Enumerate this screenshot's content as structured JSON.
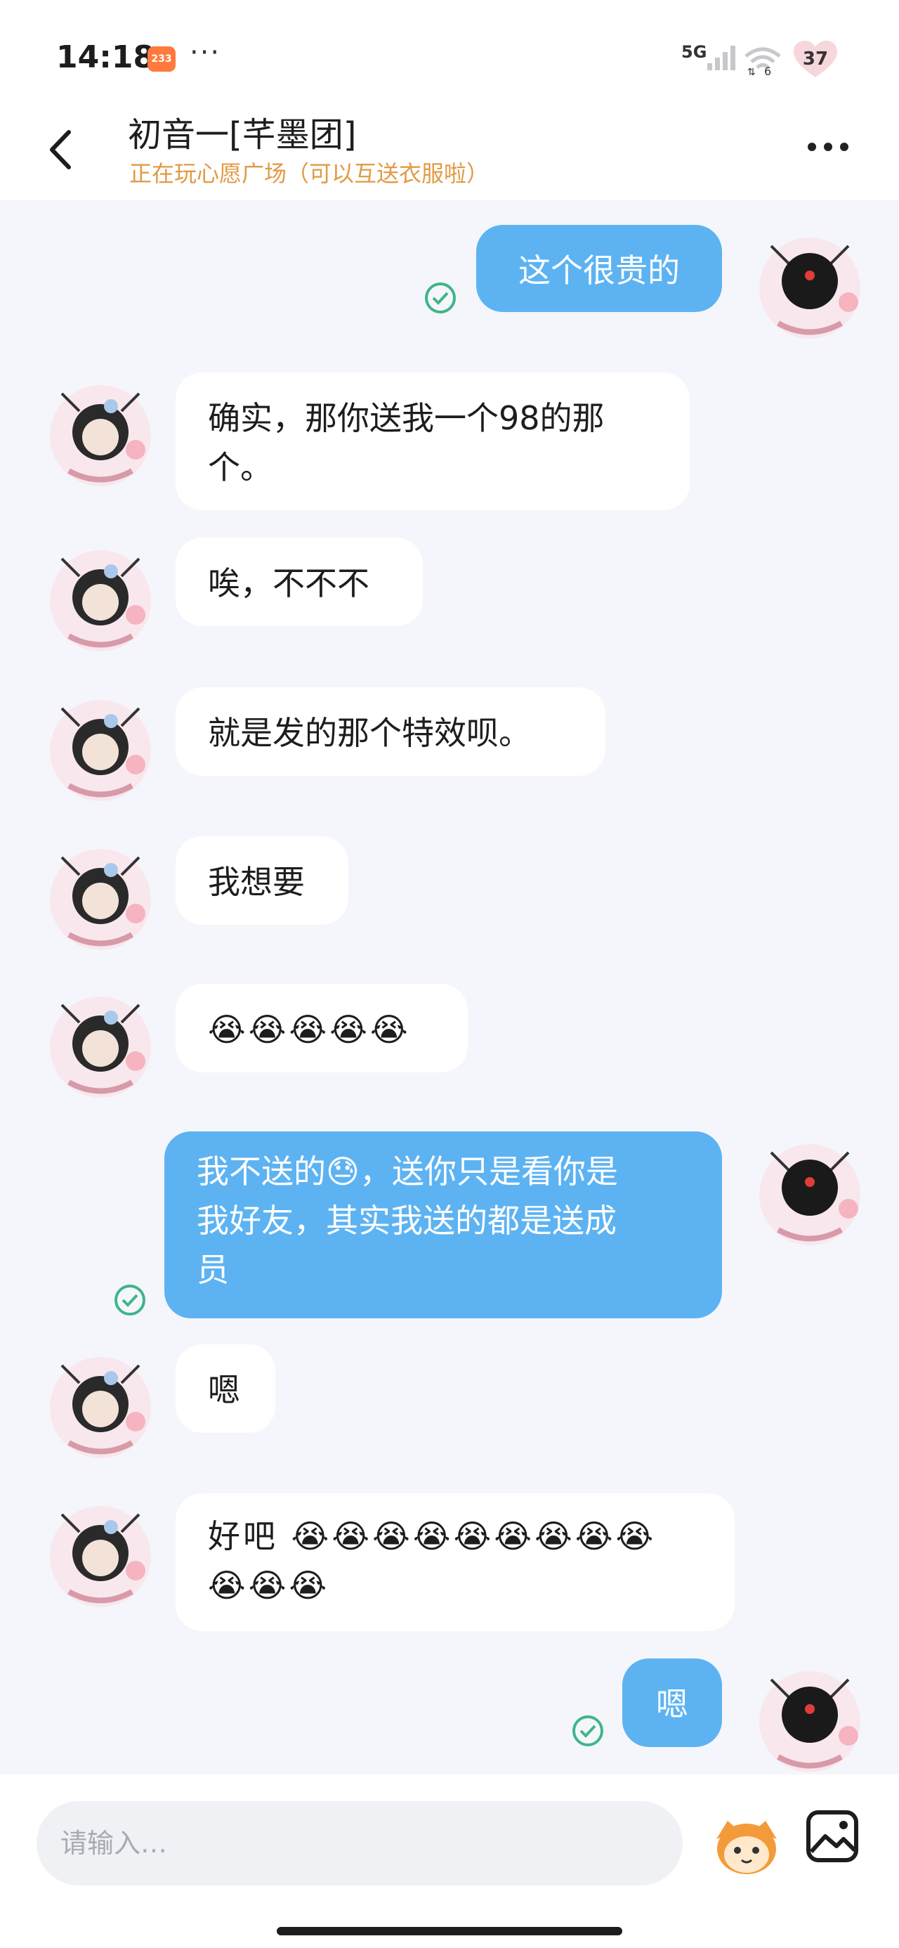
{
  "status_bar": {
    "time": "14:18",
    "app_badge": "233",
    "dots": "···",
    "network": "5G",
    "wifi_label": "6",
    "battery": "37"
  },
  "header": {
    "contact_name": "初音一[芊墨团]",
    "contact_status": "正在玩心愿广场（可以互送衣服啦）",
    "back_icon": "chevron-left-icon",
    "more_icon": "more-dots-icon"
  },
  "messages": [
    {
      "from": "me",
      "text": "这个很贵的",
      "read": true
    },
    {
      "from": "them",
      "line1": "确实，那你送我一个98的那",
      "line2": "个。"
    },
    {
      "from": "them",
      "text": "唉，不不不"
    },
    {
      "from": "them",
      "text": "就是发的那个特效呗。"
    },
    {
      "from": "them",
      "text": "我想要"
    },
    {
      "from": "them",
      "text": "😭😭😭😭😭"
    },
    {
      "from": "me",
      "line1": "我不送的😓，送你只是看你是",
      "line2": "我好友，其实我送的都是送成",
      "line3": "员",
      "read": true
    },
    {
      "from": "them",
      "text": "嗯"
    },
    {
      "from": "them",
      "line1": "好吧 😭😭😭😭😭😭😭😭😭",
      "line2": "😭😭😭"
    },
    {
      "from": "me",
      "text": "嗯",
      "read": true
    }
  ],
  "input": {
    "placeholder": "请输入…"
  },
  "colors": {
    "outgoing_bubble": "#5db3f2",
    "incoming_bubble": "#ffffff",
    "status_text": "#e19a45",
    "read_check": "#3fb58a"
  }
}
